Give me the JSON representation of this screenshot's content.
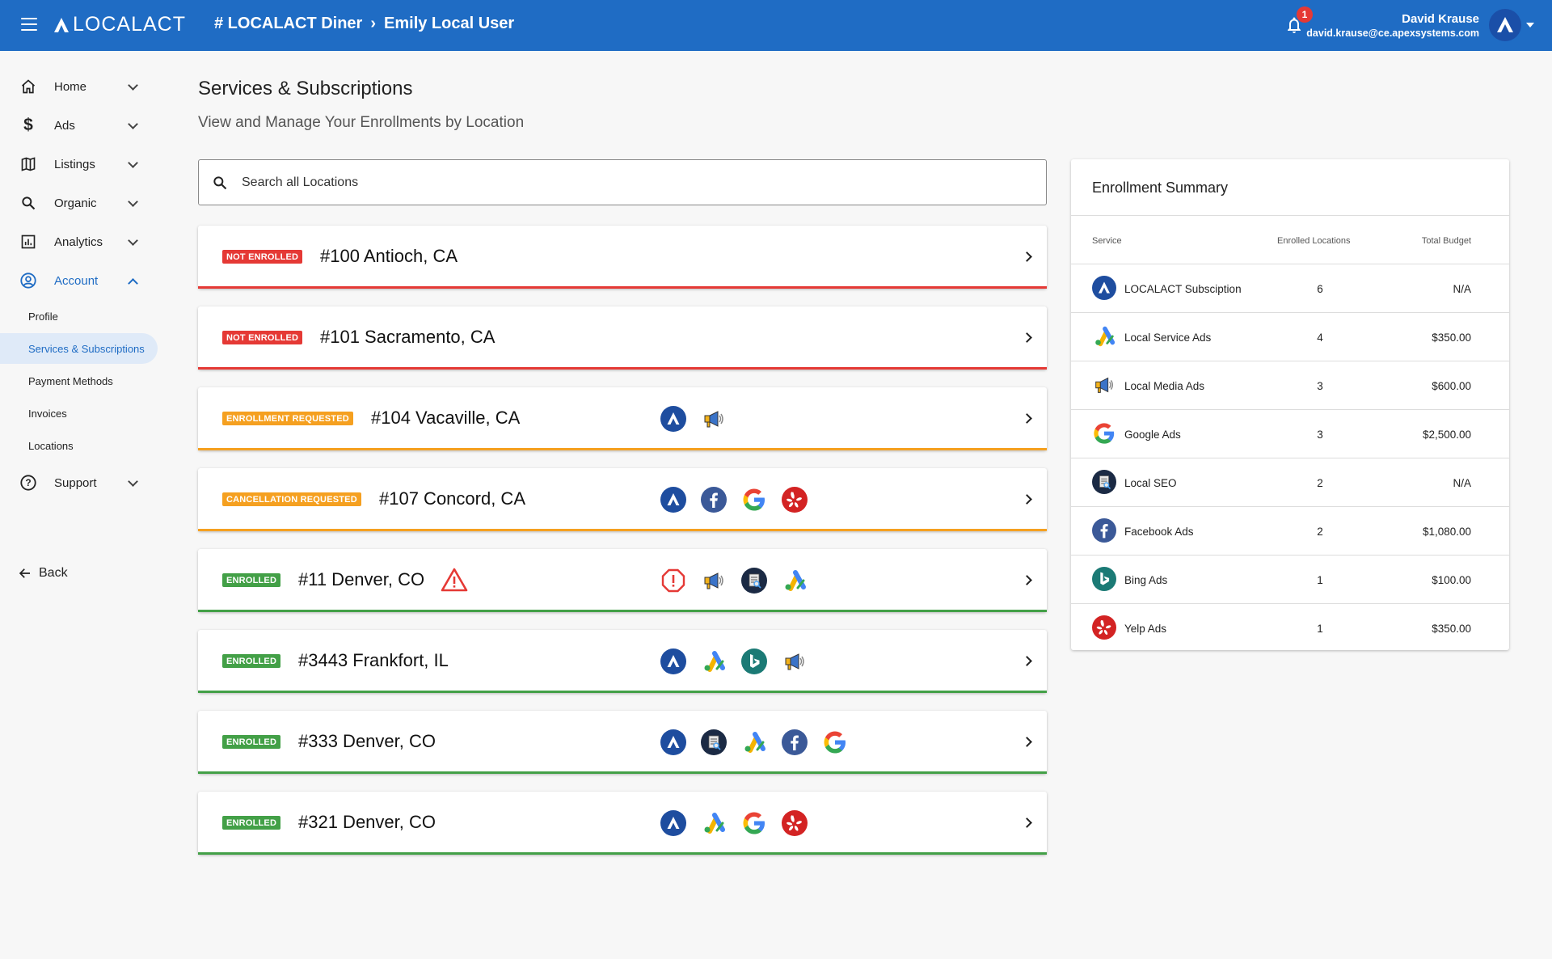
{
  "header": {
    "logo_text": "LOCALACT",
    "breadcrumb_org": "# LOCALACT Diner",
    "breadcrumb_user": "Emily Local User",
    "notification_count": "1",
    "user_name": "David Krause",
    "user_email": "david.krause@ce.apexsystems.com"
  },
  "sidebar": {
    "items": [
      {
        "label": "Home",
        "icon": "home-icon"
      },
      {
        "label": "Ads",
        "icon": "dollar-icon"
      },
      {
        "label": "Listings",
        "icon": "map-icon"
      },
      {
        "label": "Organic",
        "icon": "search-icon"
      },
      {
        "label": "Analytics",
        "icon": "chart-icon"
      },
      {
        "label": "Account",
        "icon": "account-circle-icon"
      }
    ],
    "sub_items": [
      "Profile",
      "Services & Subscriptions",
      "Payment Methods",
      "Invoices",
      "Locations"
    ],
    "support_label": "Support",
    "back_label": "Back"
  },
  "main": {
    "title": "Services & Subscriptions",
    "subtitle": "View and Manage Your Enrollments by Location",
    "search_placeholder": "Search all Locations",
    "locations": [
      {
        "status": "NOT ENROLLED",
        "name": "#100 Antioch, CA",
        "services": []
      },
      {
        "status": "NOT ENROLLED",
        "name": "#101 Sacramento, CA",
        "services": []
      },
      {
        "status": "ENROLLMENT REQUESTED",
        "name": "#104 Vacaville, CA",
        "services": [
          "localact",
          "media"
        ]
      },
      {
        "status": "CANCELLATION REQUESTED",
        "name": "#107 Concord, CA",
        "services": [
          "localact",
          "facebook",
          "google",
          "yelp"
        ]
      },
      {
        "status": "ENROLLED",
        "name": "#11 Denver, CO",
        "services": [
          "alert",
          "media",
          "seo",
          "lsa"
        ]
      },
      {
        "status": "ENROLLED",
        "name": "#3443 Frankfort, IL",
        "services": [
          "localact",
          "lsa",
          "bing",
          "media"
        ]
      },
      {
        "status": "ENROLLED",
        "name": "#333 Denver, CO",
        "services": [
          "localact",
          "seo",
          "lsa",
          "facebook",
          "google"
        ]
      },
      {
        "status": "ENROLLED",
        "name": "#321 Denver, CO",
        "services": [
          "localact",
          "lsa",
          "google",
          "yelp"
        ]
      }
    ]
  },
  "summary": {
    "title": "Enrollment Summary",
    "col_service": "Service",
    "col_enrolled": "Enrolled Locations",
    "col_budget": "Total Budget",
    "rows": [
      {
        "service": "LOCALACT Subsciption",
        "icon": "localact",
        "enrolled": "6",
        "budget": "N/A"
      },
      {
        "service": "Local Service Ads",
        "icon": "lsa",
        "enrolled": "4",
        "budget": "$350.00"
      },
      {
        "service": "Local Media Ads",
        "icon": "media",
        "enrolled": "3",
        "budget": "$600.00"
      },
      {
        "service": "Google Ads",
        "icon": "google",
        "enrolled": "3",
        "budget": "$2,500.00"
      },
      {
        "service": "Local SEO",
        "icon": "seo",
        "enrolled": "2",
        "budget": "N/A"
      },
      {
        "service": "Facebook Ads",
        "icon": "facebook",
        "enrolled": "2",
        "budget": "$1,080.00"
      },
      {
        "service": "Bing Ads",
        "icon": "bing",
        "enrolled": "1",
        "budget": "$100.00"
      },
      {
        "service": "Yelp Ads",
        "icon": "yelp",
        "enrolled": "1",
        "budget": "$350.00"
      }
    ]
  },
  "colors": {
    "brand": "#1f6cc4",
    "not_enrolled": "#e53935",
    "requested": "#f5a020",
    "enrolled": "#43a047"
  }
}
